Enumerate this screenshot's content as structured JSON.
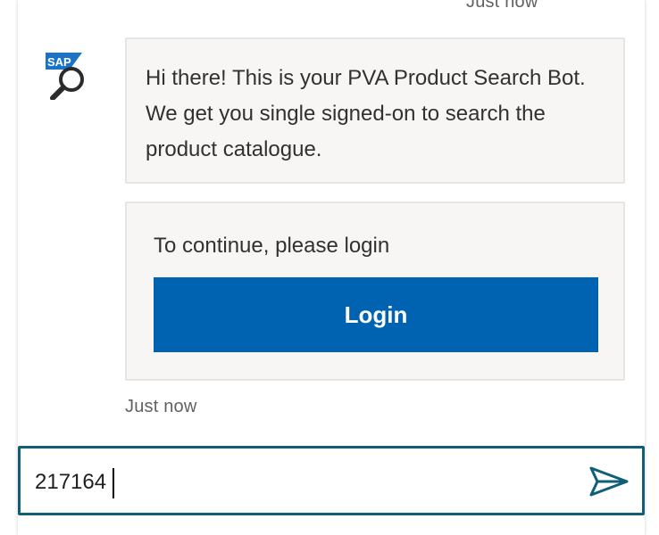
{
  "conversation": {
    "top_timestamp": "Just now",
    "bot_avatar": {
      "icon": "sap-search-magnifier-icon",
      "logo_text": "SAP",
      "logo_color": "#1a73c8"
    },
    "greeting_message": "Hi there! This is your PVA Product Search Bot. We get you single signed-on to search the product catalogue.",
    "login_card": {
      "prompt": "To continue, please login",
      "button_label": "Login",
      "button_color": "#0063b1"
    },
    "bottom_timestamp": "Just now"
  },
  "composer": {
    "input_value": "217164",
    "send_icon": "send-icon",
    "border_color": "#115e79"
  }
}
